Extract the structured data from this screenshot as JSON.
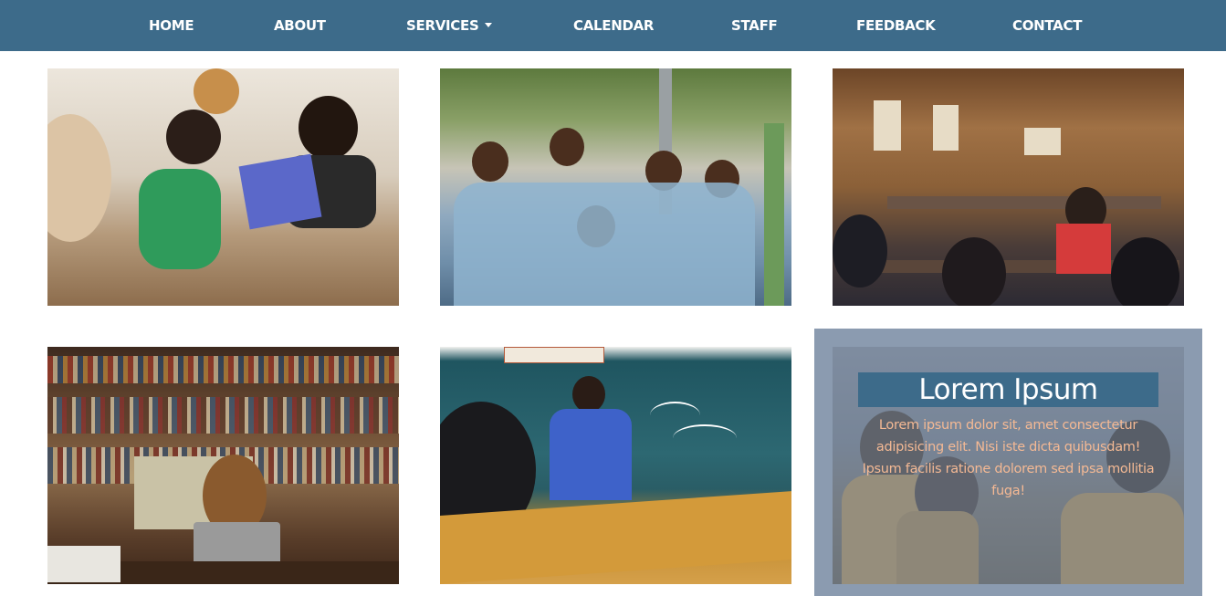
{
  "nav": {
    "items": [
      "HOME",
      "ABOUT",
      "SERVICES",
      "CALENDAR",
      "STAFF",
      "FEEDBACK",
      "CONTACT"
    ],
    "background": "#3d6b8a"
  },
  "gallery": {
    "photos": [
      "children-reading-comic-photo",
      "smiling-schoolboys-photo",
      "wooden-classroom-photo",
      "student-with-laptop-photo",
      "teacher-at-blackboard-photo"
    ]
  },
  "card": {
    "title": "Lorem Ipsum",
    "text": "Lorem ipsum dolor sit, amet consectetur adipisicing elit. Nisi iste dicta quibusdam! Ipsum facilis ratione dolorem sed ipsa mollitia fuga!",
    "title_bg": "#3d6b8a",
    "text_color": "#f4b994"
  }
}
